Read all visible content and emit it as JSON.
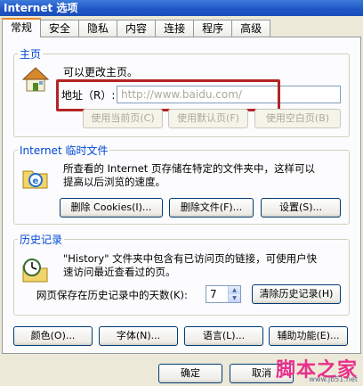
{
  "window": {
    "title": "Internet 选项"
  },
  "tabs": [
    {
      "label": "常规"
    },
    {
      "label": "安全"
    },
    {
      "label": "隐私"
    },
    {
      "label": "内容"
    },
    {
      "label": "连接"
    },
    {
      "label": "程序"
    },
    {
      "label": "高级"
    }
  ],
  "homepage": {
    "legend": "主页",
    "description": "可以更改主页。",
    "address_label": "地址（R）:",
    "address_value": "http://www.baidu.com/",
    "buttons": {
      "use_current": "使用当前页(C)",
      "use_default": "使用默认页(F)",
      "use_blank": "使用空白页(B)"
    }
  },
  "temp_files": {
    "legend": "Internet 临时文件",
    "description_line1": "所查看的 Internet 页存储在特定的文件夹中，这样可以",
    "description_line2": "提高以后浏览的速度。",
    "buttons": {
      "delete_cookies": "删除 Cookies(I)...",
      "delete_files": "删除文件(F)...",
      "settings": "设置(S)..."
    }
  },
  "history": {
    "legend": "历史记录",
    "description_line1": "\"History\" 文件夹中包含有已访问页的链接，可使用户快",
    "description_line2": "速访问最近查看过的页。",
    "days_label": "网页保存在历史记录中的天数(K):",
    "days_value": "7",
    "clear_button": "清除历史记录(H)"
  },
  "bottom_buttons": {
    "colors": "颜色(O)...",
    "fonts": "字体(N)...",
    "languages": "语言(L)...",
    "accessibility": "辅助功能(E)..."
  },
  "dialog_buttons": {
    "ok": "确定",
    "cancel": "取消"
  },
  "watermark": {
    "text": "脚本之家",
    "url": "www.jb51.net"
  }
}
